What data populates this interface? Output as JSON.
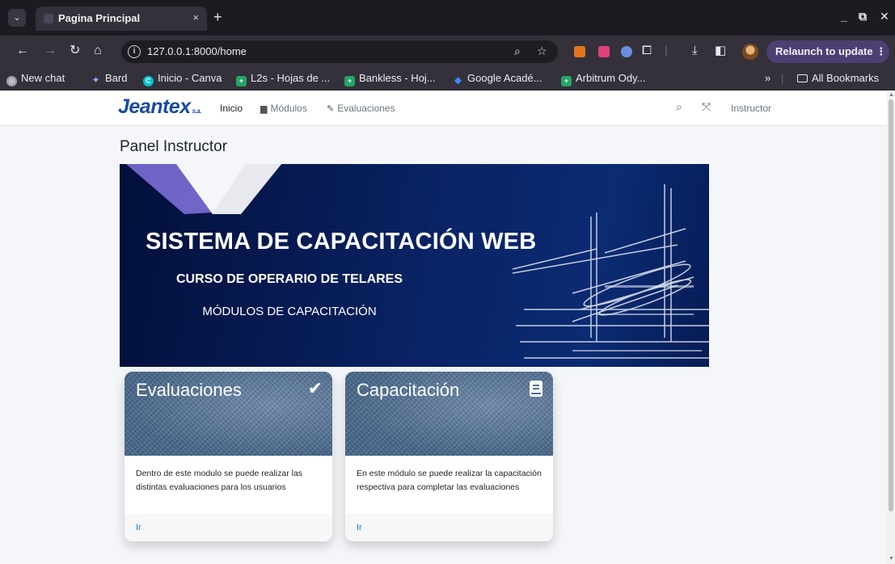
{
  "browser": {
    "tab_title": "Pagina Principal",
    "tab_close": "×",
    "new_tab": "+",
    "url": "127.0.0.1:8000/home",
    "relaunch_label": "Relaunch to update ⋮",
    "bookmarks": [
      {
        "label": "New chat",
        "icon": "openai-icon",
        "color": "#9aa0a6"
      },
      {
        "label": "Bard",
        "icon": "bard-icon",
        "color": "#8ab4f8"
      },
      {
        "label": "Inicio - Canva",
        "icon": "canva-icon",
        "color": "#00c4cc"
      },
      {
        "label": "L2s - Hojas de ...",
        "icon": "sheets-icon",
        "color": "#23a566"
      },
      {
        "label": "Bankless - Hoj...",
        "icon": "sheets-icon",
        "color": "#23a566"
      },
      {
        "label": "Google Acadé...",
        "icon": "scholar-icon",
        "color": "#4285f4"
      },
      {
        "label": "Arbitrum Ody...",
        "icon": "sheets-icon",
        "color": "#23a566"
      }
    ],
    "bookmarks_overflow": "»",
    "all_bookmarks": "All Bookmarks"
  },
  "navbar": {
    "brand": "Jeantex",
    "brand_suffix": "s.a.",
    "links": [
      {
        "label": "Inicio",
        "active": true
      },
      {
        "label": "Módulos",
        "icon": "file-icon"
      },
      {
        "label": "Evaluaciones",
        "icon": "pencil-icon"
      }
    ],
    "user": "Instructor"
  },
  "page": {
    "title": "Panel Instructor"
  },
  "banner": {
    "title": "SISTEMA DE CAPACITACIÓN WEB",
    "subtitle": "CURSO DE OPERARIO DE TELARES",
    "caption": "MÓDULOS DE CAPACITACIÓN",
    "colors": {
      "dark": "#020f3a",
      "mid": "#0b2b73",
      "accent": "#7b6fd6"
    }
  },
  "cards": [
    {
      "title": "Evaluaciones",
      "icon": "check-icon",
      "body": "Dentro de este modulo se puede realizar las distintas evaluaciones para los usuarios",
      "link": "Ir"
    },
    {
      "title": "Capacitación",
      "icon": "book-icon",
      "body": "En este módulo se puede realizar la capacitación respectiva para completar las evaluaciones",
      "link": "Ir"
    }
  ]
}
